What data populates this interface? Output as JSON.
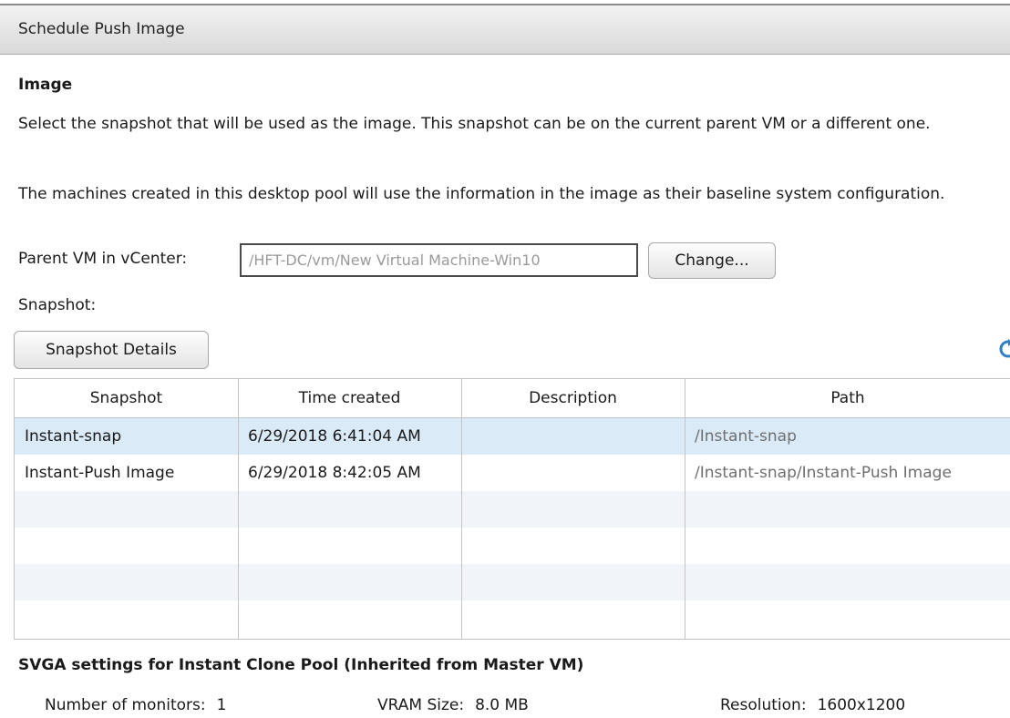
{
  "window": {
    "title": "Schedule Push Image"
  },
  "image_section": {
    "heading": "Image",
    "description1": "Select the snapshot that will be used as the image. This snapshot can be on the current parent VM or a different one.",
    "description2": "The machines created in this desktop pool will use the information in the image as their baseline system configuration."
  },
  "parent_vm": {
    "label": "Parent VM in vCenter:",
    "value": "/HFT-DC/vm/New Virtual Machine-Win10",
    "change_button": "Change..."
  },
  "snapshot": {
    "label": "Snapshot:",
    "details_button": "Snapshot Details",
    "refresh_icon": "refresh-icon",
    "columns": [
      "Snapshot",
      "Time created",
      "Description",
      "Path"
    ],
    "rows": [
      {
        "name": "Instant-snap",
        "time": "6/29/2018 6:41:04 AM",
        "description": "",
        "path": "/Instant-snap"
      },
      {
        "name": "Instant-Push Image",
        "time": "6/29/2018 8:42:05 AM",
        "description": "",
        "path": "/Instant-snap/Instant-Push Image"
      }
    ],
    "selected_row": 0
  },
  "svga": {
    "heading": "SVGA settings for Instant Clone Pool (Inherited from Master VM)",
    "monitors_label": "Number of monitors:",
    "monitors_value": "1",
    "vram_label": "VRAM Size:",
    "vram_value": "8.0 MB",
    "resolution_label": "Resolution:",
    "resolution_value": "1600x1200"
  },
  "colors": {
    "selected_row": "#dbeaf7",
    "alt_row": "#f1f4f8",
    "grid_border": "#c4c4c4"
  }
}
